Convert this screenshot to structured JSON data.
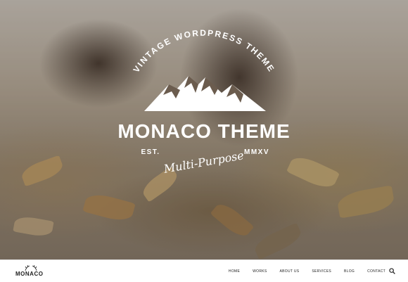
{
  "hero": {
    "arc_text": "VINTAGE WORDPRESS THEME",
    "title": "MONACO THEME",
    "est": "EST.",
    "year": "MMXV",
    "tagline": "Multi-Purpose"
  },
  "navbar": {
    "logo_text": "MONACO",
    "menu": [
      "HOME",
      "WORKS",
      "ABOUT US",
      "SERVICES",
      "BLOG",
      "CONTACT"
    ],
    "search_icon": "search-icon"
  },
  "colors": {
    "emblem": "#ffffff",
    "nav_bg": "#ffffff",
    "nav_text": "#222222"
  }
}
